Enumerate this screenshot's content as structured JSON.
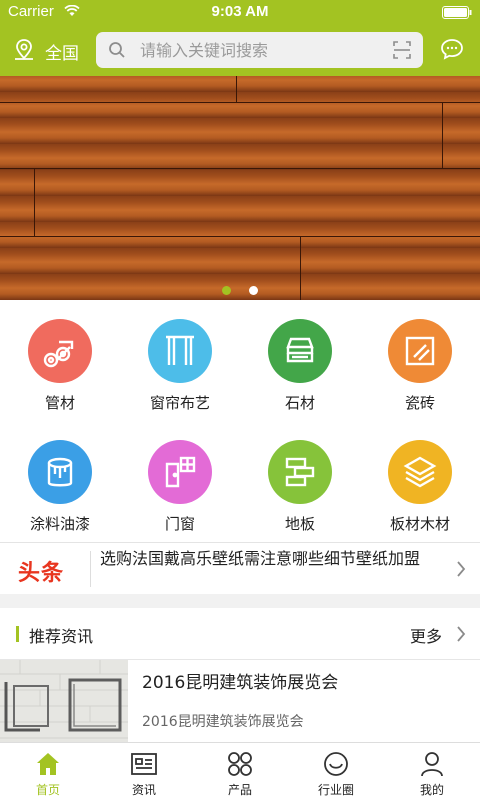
{
  "status": {
    "carrier": "Carrier",
    "time": "9:03 AM"
  },
  "header": {
    "location": "全国",
    "search_placeholder": "请输入关键词搜索"
  },
  "banner": {
    "slides": 2,
    "active_slide": 1
  },
  "categories": [
    {
      "label": "管材",
      "color": "#f06b5e",
      "icon": "pipes-icon"
    },
    {
      "label": "窗帘布艺",
      "color": "#4dbde9",
      "icon": "curtain-icon"
    },
    {
      "label": "石材",
      "color": "#43a649",
      "icon": "stone-icon"
    },
    {
      "label": "瓷砖",
      "color": "#ef8a36",
      "icon": "tile-icon"
    },
    {
      "label": "涂料油漆",
      "color": "#3b9fe6",
      "icon": "paint-bucket-icon"
    },
    {
      "label": "门窗",
      "color": "#e36bd6",
      "icon": "door-window-icon"
    },
    {
      "label": "地板",
      "color": "#86c33a",
      "icon": "floor-icon"
    },
    {
      "label": "板材木材",
      "color": "#f0b423",
      "icon": "board-icon"
    }
  ],
  "headline": {
    "logo": "头条",
    "text": "选购法国戴高乐壁纸需注意哪些细节壁纸加盟"
  },
  "recommend": {
    "title": "推荐资讯",
    "more": "更多"
  },
  "articles": [
    {
      "title": "2016昆明建筑装饰展览会",
      "summary": "2016昆明建筑装饰展览会"
    }
  ],
  "tabs": [
    {
      "label": "首页",
      "icon": "home-icon",
      "active": true
    },
    {
      "label": "资讯",
      "icon": "news-icon",
      "active": false
    },
    {
      "label": "产品",
      "icon": "products-icon",
      "active": false
    },
    {
      "label": "行业圈",
      "icon": "circle-icon",
      "active": false
    },
    {
      "label": "我的",
      "icon": "user-icon",
      "active": false
    }
  ],
  "colors": {
    "brand": "#a3c322",
    "headline_red": "#e8351f"
  }
}
